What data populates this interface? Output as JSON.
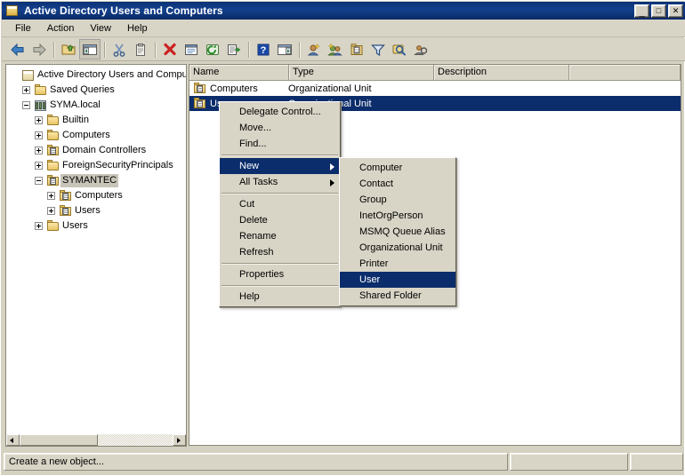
{
  "window": {
    "title": "Active Directory Users and Computers",
    "icon": "console-window-icon",
    "buttons": {
      "minimize": "_",
      "maximize": "□",
      "close": "✕"
    }
  },
  "menubar": {
    "items": [
      {
        "label": "File",
        "name": "menu-file"
      },
      {
        "label": "Action",
        "name": "menu-action"
      },
      {
        "label": "View",
        "name": "menu-view"
      },
      {
        "label": "Help",
        "name": "menu-help"
      }
    ]
  },
  "toolbar": {
    "buttons": [
      {
        "name": "back-icon",
        "tooltip": "Back"
      },
      {
        "name": "forward-icon",
        "tooltip": "Forward"
      },
      {
        "name": "up-one-level-icon",
        "tooltip": "Up One Level"
      },
      {
        "name": "show-hide-tree-icon",
        "tooltip": "Show/Hide Console Tree",
        "pressed": true
      },
      {
        "name": "cut-icon",
        "tooltip": "Cut"
      },
      {
        "name": "copy-icon",
        "tooltip": "Copy"
      },
      {
        "name": "delete-icon",
        "tooltip": "Delete"
      },
      {
        "name": "properties-icon",
        "tooltip": "Properties"
      },
      {
        "name": "refresh-icon",
        "tooltip": "Refresh"
      },
      {
        "name": "export-list-icon",
        "tooltip": "Export List"
      },
      {
        "name": "help-icon",
        "tooltip": "Help"
      },
      {
        "name": "show-action-pane-icon",
        "tooltip": "Show/Hide Action Pane"
      },
      {
        "name": "new-user-icon",
        "tooltip": "Create a new user"
      },
      {
        "name": "new-group-icon",
        "tooltip": "Create a new group"
      },
      {
        "name": "new-ou-icon",
        "tooltip": "Create a new Organizational Unit"
      },
      {
        "name": "filter-icon",
        "tooltip": "Filter"
      },
      {
        "name": "find-icon",
        "tooltip": "Find"
      },
      {
        "name": "saved-query-icon",
        "tooltip": "New Query"
      }
    ]
  },
  "tree": {
    "nodes": [
      {
        "label": "Active Directory Users and Comput",
        "indent": 0,
        "expander": "none",
        "icon": "console-icon",
        "selected": false,
        "name": "tree-node-root"
      },
      {
        "label": "Saved Queries",
        "indent": 1,
        "expander": "plus",
        "icon": "folder-icon",
        "selected": false,
        "name": "tree-node-saved-queries"
      },
      {
        "label": "SYMA.local",
        "indent": 1,
        "expander": "minus",
        "icon": "domain-icon",
        "selected": false,
        "name": "tree-node-syma-local"
      },
      {
        "label": "Builtin",
        "indent": 2,
        "expander": "plus",
        "icon": "folder-icon",
        "selected": false,
        "name": "tree-node-builtin"
      },
      {
        "label": "Computers",
        "indent": 2,
        "expander": "plus",
        "icon": "folder-icon",
        "selected": false,
        "name": "tree-node-computers"
      },
      {
        "label": "Domain Controllers",
        "indent": 2,
        "expander": "plus",
        "icon": "ou-icon",
        "selected": false,
        "name": "tree-node-domain-controllers"
      },
      {
        "label": "ForeignSecurityPrincipals",
        "indent": 2,
        "expander": "plus",
        "icon": "folder-icon",
        "selected": false,
        "name": "tree-node-foreign-security-principals"
      },
      {
        "label": "SYMANTEC",
        "indent": 2,
        "expander": "minus",
        "icon": "ou-icon",
        "selected": true,
        "name": "tree-node-symantec"
      },
      {
        "label": "Computers",
        "indent": 3,
        "expander": "plus",
        "icon": "ou-icon",
        "selected": false,
        "name": "tree-node-symantec-computers"
      },
      {
        "label": "Users",
        "indent": 3,
        "expander": "plus",
        "icon": "ou-icon",
        "selected": false,
        "name": "tree-node-symantec-users"
      },
      {
        "label": "Users",
        "indent": 2,
        "expander": "plus",
        "icon": "folder-icon",
        "selected": false,
        "name": "tree-node-users"
      }
    ]
  },
  "list": {
    "columns": [
      {
        "label": "Name",
        "name": "column-header-name"
      },
      {
        "label": "Type",
        "name": "column-header-type"
      },
      {
        "label": "Description",
        "name": "column-header-description"
      }
    ],
    "rows": [
      {
        "name": "Computers",
        "type": "Organizational Unit",
        "description": "",
        "icon": "ou-icon",
        "selected": false
      },
      {
        "name": "Users",
        "type": "Organizational Unit",
        "description": "",
        "icon": "ou-icon",
        "selected": true
      }
    ]
  },
  "context_menu": {
    "items": [
      {
        "label": "Delegate Control...",
        "type": "item",
        "name": "ctx-delegate-control"
      },
      {
        "label": "Move...",
        "type": "item",
        "name": "ctx-move"
      },
      {
        "label": "Find...",
        "type": "item",
        "name": "ctx-find"
      },
      {
        "type": "separator"
      },
      {
        "label": "New",
        "type": "submenu",
        "highlighted": true,
        "name": "ctx-new"
      },
      {
        "label": "All Tasks",
        "type": "submenu",
        "name": "ctx-all-tasks"
      },
      {
        "type": "separator"
      },
      {
        "label": "Cut",
        "type": "item",
        "name": "ctx-cut"
      },
      {
        "label": "Delete",
        "type": "item",
        "name": "ctx-delete"
      },
      {
        "label": "Rename",
        "type": "item",
        "name": "ctx-rename"
      },
      {
        "label": "Refresh",
        "type": "item",
        "name": "ctx-refresh"
      },
      {
        "type": "separator"
      },
      {
        "label": "Properties",
        "type": "item",
        "name": "ctx-properties"
      },
      {
        "type": "separator"
      },
      {
        "label": "Help",
        "type": "item",
        "name": "ctx-help"
      }
    ]
  },
  "submenu": {
    "items": [
      {
        "label": "Computer",
        "name": "submenu-computer"
      },
      {
        "label": "Contact",
        "name": "submenu-contact"
      },
      {
        "label": "Group",
        "name": "submenu-group"
      },
      {
        "label": "InetOrgPerson",
        "name": "submenu-inetorgperson"
      },
      {
        "label": "MSMQ Queue Alias",
        "name": "submenu-msmq-queue-alias"
      },
      {
        "label": "Organizational Unit",
        "name": "submenu-organizational-unit"
      },
      {
        "label": "Printer",
        "name": "submenu-printer"
      },
      {
        "label": "User",
        "highlighted": true,
        "name": "submenu-user"
      },
      {
        "label": "Shared Folder",
        "name": "submenu-shared-folder"
      }
    ]
  },
  "statusbar": {
    "message": "Create a new object...",
    "pane2": "",
    "pane3": ""
  },
  "colors": {
    "titlebar": "#0c3277",
    "selection": "#0c2d6b",
    "face": "#d8d4c6",
    "tree_selected_bg": "#c8c4b8"
  }
}
